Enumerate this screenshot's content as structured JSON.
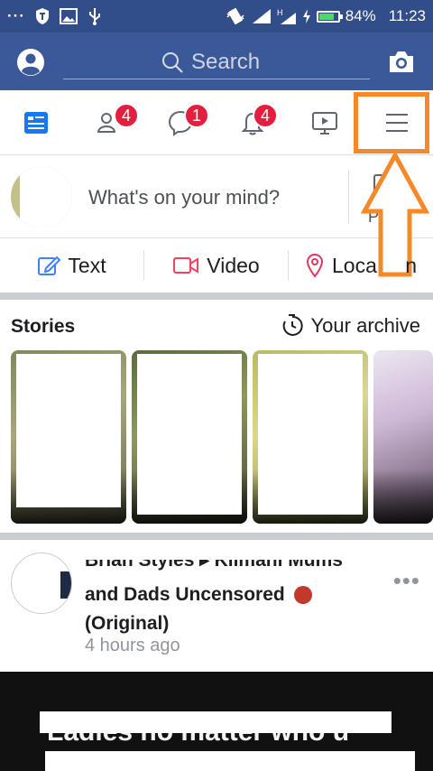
{
  "status_bar": {
    "battery_percent": "84%",
    "time": "11:23",
    "battery_level": 0.84,
    "icons": [
      "more-icon",
      "shield-icon",
      "image-icon",
      "usb-icon",
      "vibrate-icon",
      "signal-icon",
      "h-signal-icon",
      "charging-icon",
      "battery-icon"
    ]
  },
  "header": {
    "search_placeholder": "Search",
    "icons": [
      "profile-icon",
      "search-icon",
      "camera-icon"
    ]
  },
  "nav": {
    "tabs": [
      {
        "name": "news-feed",
        "icon": "news-feed-icon",
        "badge": ""
      },
      {
        "name": "friend-requests",
        "icon": "friends-icon",
        "badge": "4"
      },
      {
        "name": "messages",
        "icon": "messenger-icon",
        "badge": "1"
      },
      {
        "name": "notifications",
        "icon": "bell-icon",
        "badge": "4"
      },
      {
        "name": "watch",
        "icon": "video-icon",
        "badge": ""
      },
      {
        "name": "menu",
        "icon": "hamburger-menu-icon",
        "badge": ""
      }
    ]
  },
  "composer": {
    "prompt": "What's on your mind?",
    "peek_letter": "P"
  },
  "post_actions": {
    "text_label": "Text",
    "video_label": "Video",
    "location_label": "Loca",
    "location_tail": "n"
  },
  "stories": {
    "title": "Stories",
    "archive_label": "Your archive"
  },
  "feed_post": {
    "author_line1": "Brian Styles ▸ Kilmani Mums",
    "author_line2": "and Dads Uncensored",
    "author_line3": "(Original)",
    "time": "4 hours ago",
    "menu": "•••"
  },
  "post_content": {
    "caption": "Ladies no matter who u"
  },
  "colors": {
    "header_blue": "#3b5998",
    "status_blue": "#324e8a",
    "badge_red": "#e41e3f",
    "highlight_orange": "#f5892a"
  }
}
